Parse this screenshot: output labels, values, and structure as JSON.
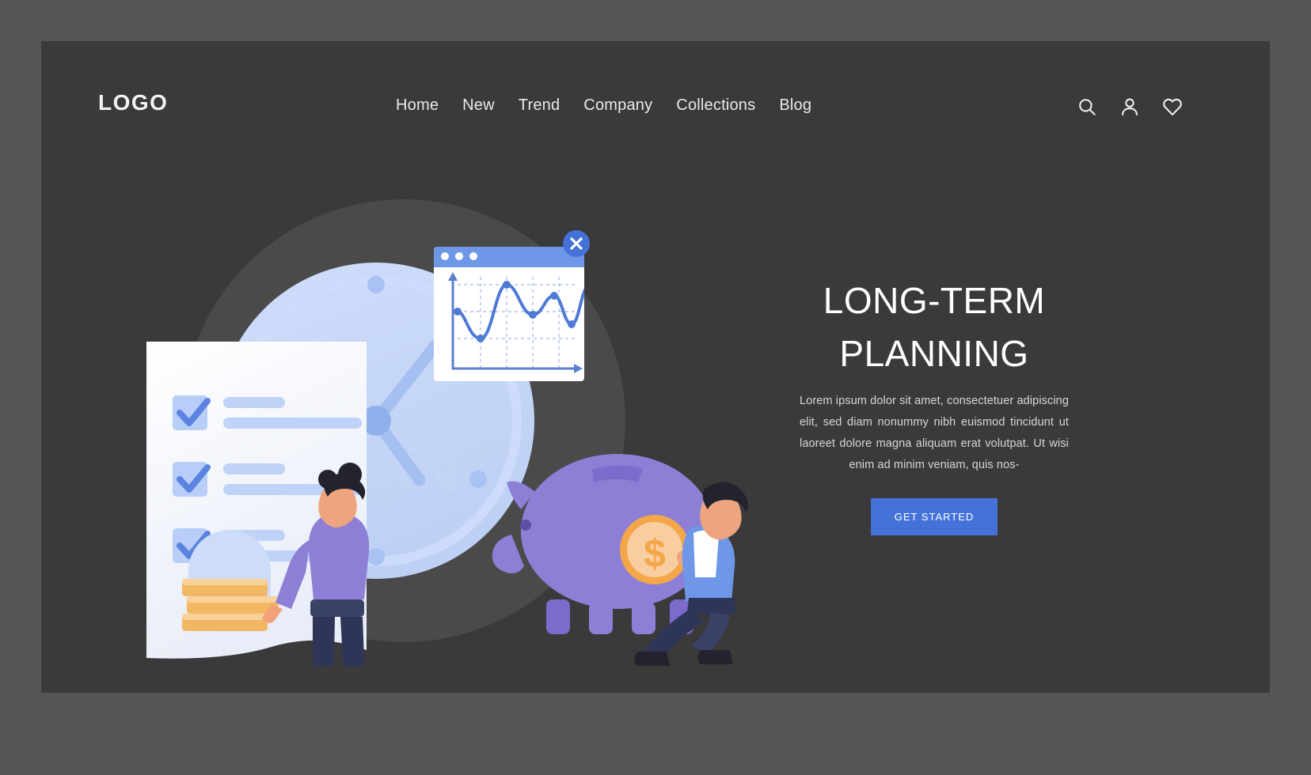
{
  "header": {
    "logo": "LOGO",
    "nav": [
      {
        "label": "Home"
      },
      {
        "label": "New"
      },
      {
        "label": "Trend"
      },
      {
        "label": "Company"
      },
      {
        "label": "Collections"
      },
      {
        "label": "Blog"
      }
    ],
    "icons": [
      {
        "name": "search-icon"
      },
      {
        "name": "user-icon"
      },
      {
        "name": "heart-icon"
      }
    ]
  },
  "hero": {
    "title": "LONG-TERM\nPLANNING",
    "paragraph": "Lorem ipsum dolor sit amet, consectetuer adipiscing elit, sed diam nonummy nibh euismod tincidunt ut laoreet dolore magna aliquam erat volutpat. Ut wisi enim ad minim veniam, quis nos-",
    "cta_label": "GET STARTED"
  },
  "illustration": {
    "clock_label": "PLAN",
    "coin_symbol": "$",
    "close_symbol": "✕",
    "checklist_items": 3,
    "colors": {
      "page_bg": "#565656",
      "card_bg": "#3a3a3a",
      "accent_blue": "#4472d8",
      "light_blue": "#bcd0f5",
      "pale_blue": "#dbe6fb",
      "piggy_purple": "#8d7fd6",
      "coin_gold": "#f3a748",
      "coin_face": "#f8cda0",
      "navy": "#2f3556",
      "white": "#ffffff"
    }
  },
  "chart_data": {
    "type": "line",
    "title": "",
    "x": [
      0,
      1,
      2,
      3,
      4,
      5,
      6,
      7
    ],
    "values": [
      52,
      20,
      82,
      44,
      66,
      30,
      46,
      78
    ],
    "xlabel": "",
    "ylabel": "",
    "grid": true,
    "legend": false
  }
}
